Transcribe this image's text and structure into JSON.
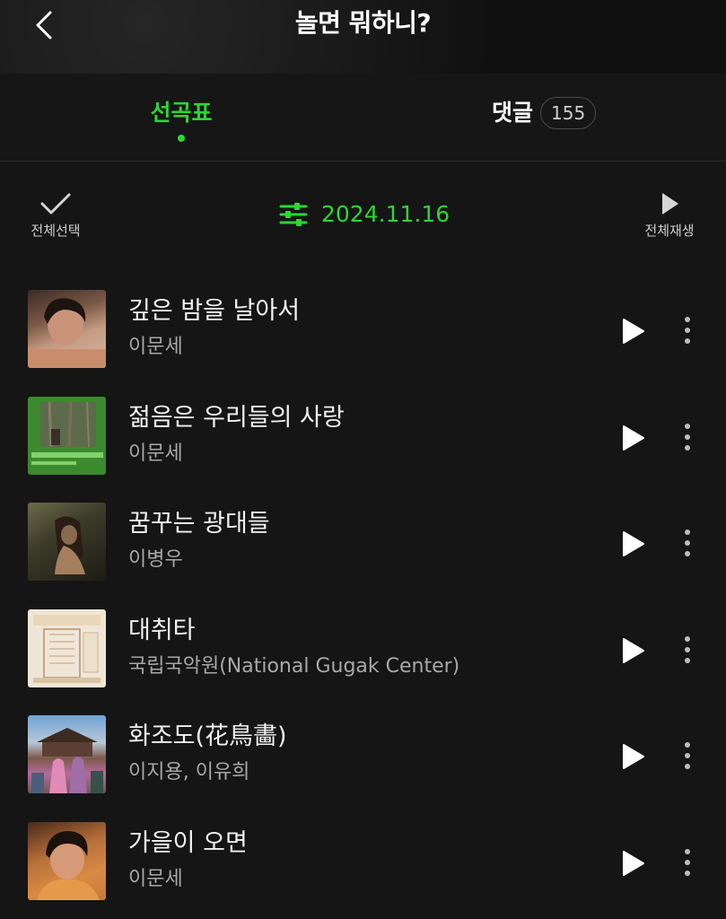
{
  "header": {
    "title": "놀면 뭐하니?"
  },
  "tabs": [
    {
      "label": "선곡표",
      "active": true
    },
    {
      "label": "댓글",
      "count": "155",
      "active": false
    }
  ],
  "toolbar": {
    "select_all_label": "전체선택",
    "date": "2024.11.16",
    "play_all_label": "전체재생"
  },
  "songs": [
    {
      "title": "깊은 밤을 날아서",
      "artist": "이문세"
    },
    {
      "title": "젊음은 우리들의 사랑",
      "artist": "이문세"
    },
    {
      "title": "꿈꾸는 광대들",
      "artist": "이병우"
    },
    {
      "title": "대취타",
      "artist": "국립국악원(National Gugak Center)"
    },
    {
      "title": "화조도(花鳥畵)",
      "artist": "이지용, 이유희"
    },
    {
      "title": "가을이 오면",
      "artist": "이문세"
    }
  ],
  "colors": {
    "accent": "#2dd534",
    "background": "#151515",
    "secondary_text": "#a8a8a8"
  },
  "icons": {
    "back": "chevron-left-icon",
    "select_all": "check-icon",
    "filter": "sliders-icon",
    "play_all": "play-icon",
    "play": "play-icon",
    "more": "more-vertical-icon"
  }
}
